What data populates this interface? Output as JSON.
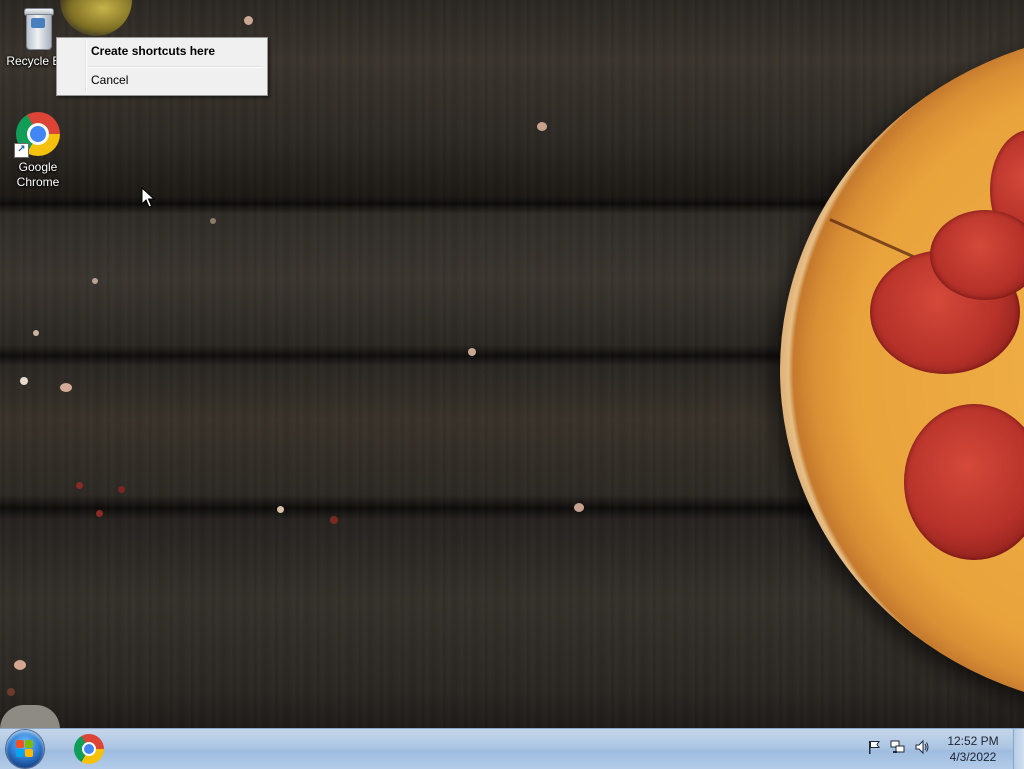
{
  "desktop": {
    "icons": [
      {
        "label": "Recycle Bin",
        "icon": "recycle-bin-icon"
      },
      {
        "label": "Google Chrome",
        "icon": "chrome-icon",
        "shortcut": true
      }
    ]
  },
  "context_menu": {
    "items": [
      {
        "label": "Create shortcuts here",
        "default": true
      },
      {
        "label": "Cancel",
        "default": false
      }
    ]
  },
  "taskbar": {
    "start_icon": "windows-start-icon",
    "pinned": [
      {
        "app": "Google Chrome",
        "icon": "chrome-icon"
      }
    ],
    "tray_icons": [
      "action-center-flag-icon",
      "network-icon",
      "volume-icon"
    ],
    "clock": {
      "time": "12:52 PM",
      "date": "4/3/2022"
    }
  },
  "colors": {
    "taskbar": "#adc6e3",
    "menu_bg": "#f0f0f0",
    "wallpaper_wood": "#2c2823"
  }
}
